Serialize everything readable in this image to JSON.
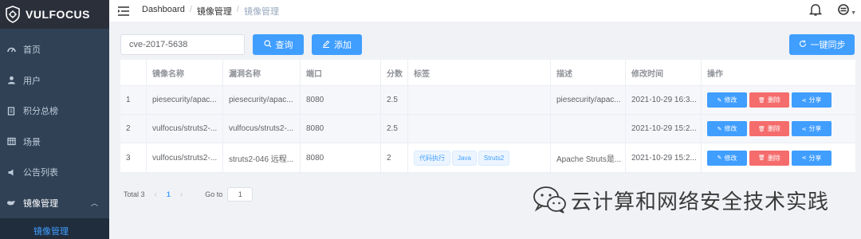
{
  "brand": "VULFOCUS",
  "sidebar": {
    "items": [
      {
        "label": "首页",
        "icon": "dashboard-icon"
      },
      {
        "label": "用户",
        "icon": "user-icon"
      },
      {
        "label": "积分总榜",
        "icon": "rank-icon"
      },
      {
        "label": "场景",
        "icon": "table-icon"
      },
      {
        "label": "公告列表",
        "icon": "notice-icon"
      },
      {
        "label": "镜像管理",
        "icon": "image-icon"
      }
    ],
    "submenu": {
      "label": "镜像管理"
    }
  },
  "breadcrumb": {
    "home": "Dashboard",
    "level1": "镜像管理",
    "current": "镜像管理"
  },
  "toolbar": {
    "search_value": "cve-2017-5638",
    "query_label": "查询",
    "add_label": "添加",
    "sync_label": "一键同步"
  },
  "table": {
    "headers": [
      "",
      "镜像名称",
      "漏洞名称",
      "端口",
      "分数",
      "标签",
      "描述",
      "修改时间",
      "操作"
    ],
    "rows": [
      {
        "index": "1",
        "image": "piesecurity/apac...",
        "vuln": "piesecurity/apac...",
        "port": "8080",
        "score": "2.5",
        "tags": [],
        "desc": "piesecurity/apac...",
        "time": "2021-10-29 16:3..."
      },
      {
        "index": "2",
        "image": "vulfocus/struts2-...",
        "vuln": "vulfocus/struts2-...",
        "port": "8080",
        "score": "2.5",
        "tags": [],
        "desc": "",
        "time": "2021-10-29 15:2..."
      },
      {
        "index": "3",
        "image": "vulfocus/struts2-...",
        "vuln": "struts2-046 远程...",
        "port": "8080",
        "score": "2",
        "tags": [
          "代码执行",
          "Java",
          "Struts2"
        ],
        "desc": "Apache Struts是...",
        "time": "2021-10-29 15:2..."
      }
    ],
    "actions": {
      "edit": "修改",
      "delete": "删除",
      "share": "分享"
    }
  },
  "pagination": {
    "total": "Total 3",
    "page": "1",
    "goto_label": "Go to",
    "goto_value": "1"
  },
  "watermark": {
    "text": "云计算和网络安全技术实践"
  },
  "colors": {
    "sidebar": "#304156",
    "primary": "#409eff",
    "danger": "#f56c6c"
  }
}
